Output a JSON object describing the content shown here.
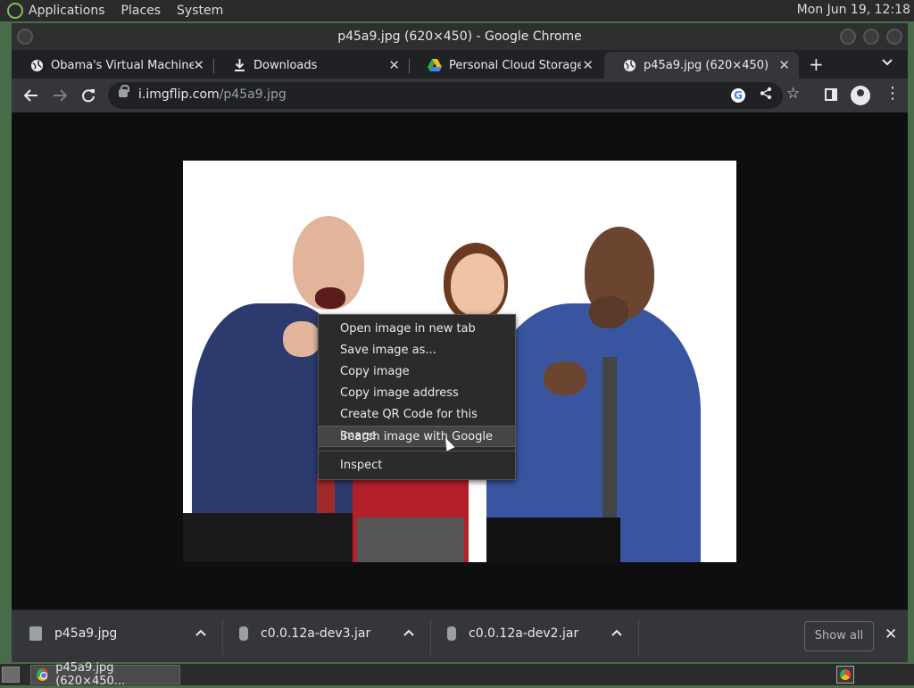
{
  "top_panel": {
    "menus": [
      "Applications",
      "Places",
      "System"
    ],
    "clock": "Mon Jun 19, 12:18"
  },
  "window": {
    "title": "p45a9.jpg (620×450) - Google Chrome"
  },
  "tabs": [
    {
      "title": "Obama's Virtual Machines!",
      "icon": "globe-icon",
      "active": false
    },
    {
      "title": "Downloads",
      "icon": "download-icon",
      "active": false
    },
    {
      "title": "Personal Cloud Storage & F",
      "icon": "drive-icon",
      "active": false
    },
    {
      "title": "p45a9.jpg (620×450)",
      "icon": "globe-icon",
      "active": true
    }
  ],
  "address_bar": {
    "host": "i.imgflip.com",
    "path": "/p45a9.jpg"
  },
  "context_menu": {
    "items": [
      "Open image in new tab",
      "Save image as...",
      "Copy image",
      "Copy image address",
      "Create QR Code for this image",
      "Search image with Google"
    ],
    "highlighted": "Search image with Google",
    "inspect": "Inspect"
  },
  "downloads": {
    "items": [
      "p45a9.jpg",
      "c0.0.12a-dev3.jar",
      "c0.0.12a-dev2.jar"
    ],
    "show_all": "Show all"
  },
  "taskbar": {
    "task_title": "p45a9.jpg (620×450..."
  },
  "colors": {
    "chrome_dark": "#35363a",
    "tabstrip": "#202124",
    "shirt_blue": "#3a55a0",
    "shirt_navy": "#2c3a6e",
    "shirt_red": "#b3202a"
  }
}
